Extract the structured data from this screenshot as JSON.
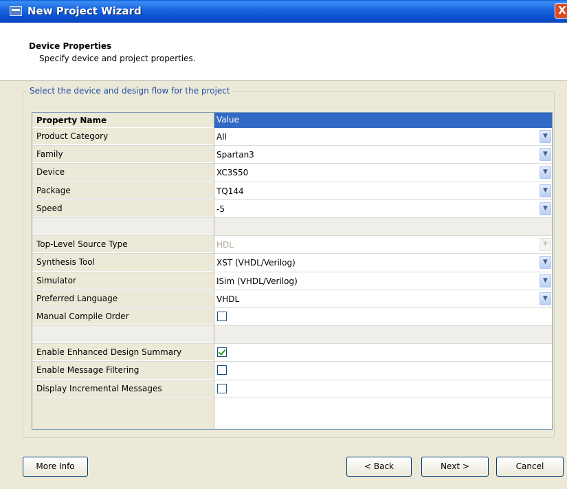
{
  "window": {
    "title": "New Project Wizard",
    "close": "X"
  },
  "header": {
    "title": "Device Properties",
    "subtitle": "Specify device and project properties."
  },
  "group": {
    "legend": "Select the device and design flow for the project"
  },
  "table": {
    "col_name": "Property Name",
    "col_value": "Value",
    "rows": [
      {
        "type": "dropdown",
        "name": "Product Category",
        "value": "All"
      },
      {
        "type": "dropdown",
        "name": "Family",
        "value": "Spartan3"
      },
      {
        "type": "dropdown",
        "name": "Device",
        "value": "XC3S50"
      },
      {
        "type": "dropdown",
        "name": "Package",
        "value": "TQ144"
      },
      {
        "type": "dropdown",
        "name": "Speed",
        "value": "-5"
      },
      {
        "type": "blank",
        "name": "",
        "value": ""
      },
      {
        "type": "dropdown",
        "name": "Top-Level Source Type",
        "value": "HDL",
        "disabled": true
      },
      {
        "type": "dropdown",
        "name": "Synthesis Tool",
        "value": "XST (VHDL/Verilog)"
      },
      {
        "type": "dropdown",
        "name": "Simulator",
        "value": "ISim (VHDL/Verilog)"
      },
      {
        "type": "dropdown",
        "name": "Preferred Language",
        "value": "VHDL"
      },
      {
        "type": "checkbox",
        "name": "Manual Compile Order",
        "checked": false
      },
      {
        "type": "blank",
        "name": "",
        "value": ""
      },
      {
        "type": "checkbox",
        "name": "Enable Enhanced Design Summary",
        "checked": true
      },
      {
        "type": "checkbox",
        "name": "Enable Message Filtering",
        "checked": false
      },
      {
        "type": "checkbox",
        "name": "Display Incremental Messages",
        "checked": false
      }
    ]
  },
  "buttons": {
    "more_info": "More Info",
    "back": "< Back",
    "next": "Next >",
    "cancel": "Cancel"
  }
}
